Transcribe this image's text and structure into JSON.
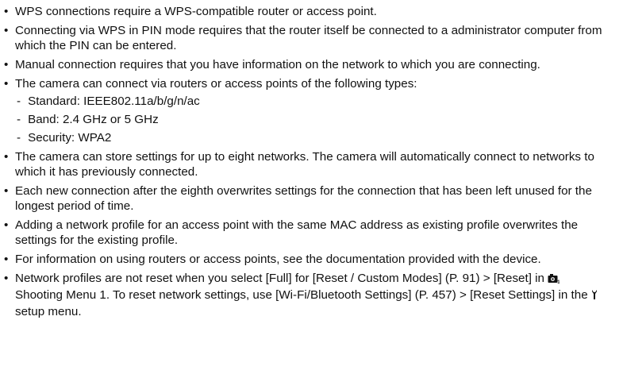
{
  "bullets": [
    {
      "text": "WPS connections require a WPS-compatible router or access point."
    },
    {
      "text": "Connecting via WPS in PIN mode requires that the router itself be connected to a administrator computer from which the PIN can be entered."
    },
    {
      "text": "Manual connection requires that you have information on the network to which you are connecting."
    },
    {
      "text": "The camera can connect via routers or access points of the following types:"
    },
    {
      "text": "The camera can store settings for up to eight networks. The camera will automatically connect to networks to which it has previously connected."
    },
    {
      "text": "Each new connection after the eighth overwrites settings for the connection that has been left unused for the longest period of time."
    },
    {
      "text": "Adding a network profile for an access point with the same MAC address as existing profile overwrites the settings for the existing profile."
    },
    {
      "text": "For information on using routers or access points, see the documentation provided with the device."
    }
  ],
  "types_list": [
    {
      "dash": "-",
      "text": "Standard: IEEE802.11a/b/g/n/ac"
    },
    {
      "dash": "-",
      "text": "Band: 2.4 GHz or 5 GHz"
    },
    {
      "dash": "-",
      "text": "Security: WPA2"
    }
  ],
  "last_bullet": {
    "part1": "Network profiles are not reset when you select [Full] for [Reset / Custom Modes] (P. 91) > [Reset] in ",
    "shooting_icon": "camera-shooting-icon",
    "part2": " Shooting Menu 1. To reset network settings, use [Wi-Fi/Bluetooth Settings] (P. 457) > [Reset Settings] in the ",
    "setup_icon": "wrench-setup-icon",
    "part3": " setup menu."
  }
}
